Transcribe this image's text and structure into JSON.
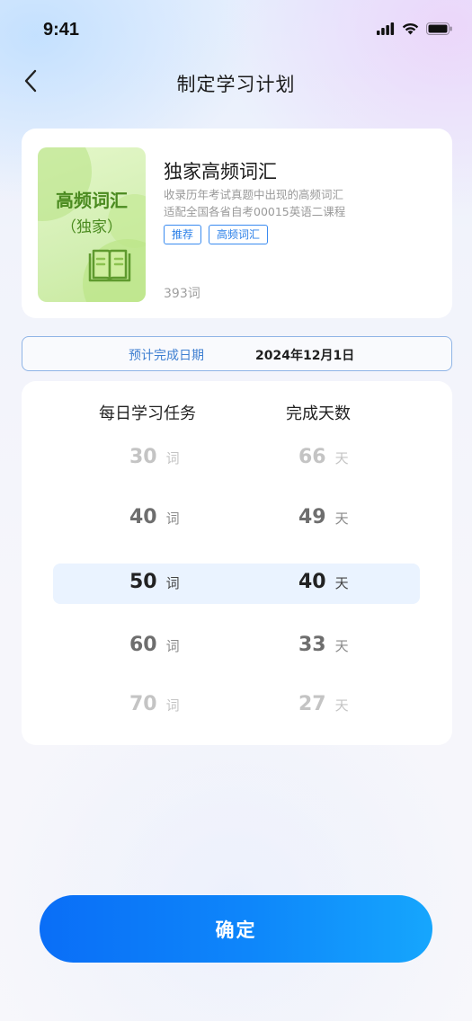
{
  "status_bar": {
    "time": "9:41"
  },
  "nav": {
    "title": "制定学习计划"
  },
  "book": {
    "cover_title": "高频词汇",
    "cover_subtitle": "（独家）",
    "name": "独家高频词汇",
    "description_line1": "收录历年考试真题中出现的高频词汇",
    "description_line2": "适配全国各省自考00015英语二课程",
    "tags": [
      "推荐",
      "高频词汇"
    ],
    "word_count": "393词"
  },
  "completion": {
    "label": "预计完成日期",
    "date": "2024年12月1日"
  },
  "picker": {
    "left_header": "每日学习任务",
    "right_header": "完成天数",
    "left_unit": "词",
    "right_unit": "天",
    "rows": [
      {
        "words": "30",
        "days": "66"
      },
      {
        "words": "40",
        "days": "49"
      },
      {
        "words": "50",
        "days": "40"
      },
      {
        "words": "60",
        "days": "33"
      },
      {
        "words": "70",
        "days": "27"
      }
    ],
    "selected_index": 2
  },
  "confirm_label": "确定",
  "colors": {
    "accent": "#0a7af7",
    "tag_border": "#3a8bf0",
    "cover_green": "#4a8a1f"
  },
  "icons": {
    "back": "chevron-left-icon",
    "signal": "signal-icon",
    "wifi": "wifi-icon",
    "battery": "battery-icon",
    "book": "open-book-icon"
  }
}
